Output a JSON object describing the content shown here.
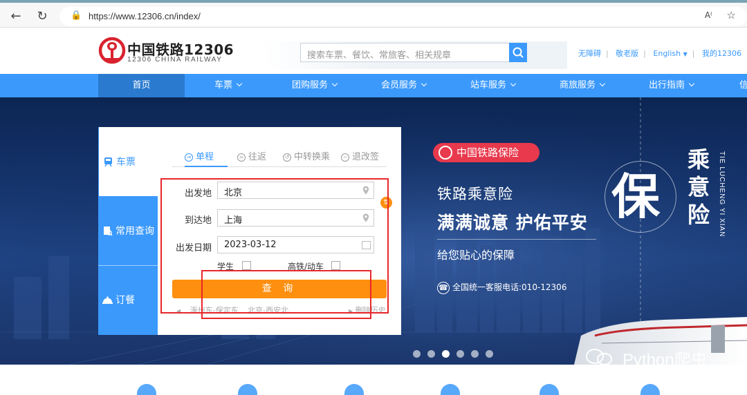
{
  "browser": {
    "url": "https://www.12306.cn/index/"
  },
  "header": {
    "logo_cn": "中国铁路12306",
    "logo_en": "12306 CHINA RAILWAY",
    "search_placeholder": "搜索车票、餐饮、常旅客、相关规章",
    "links": [
      "无障碍",
      "敬老版",
      "English",
      "我的12306"
    ]
  },
  "nav": {
    "items": [
      {
        "label": "首页",
        "dropdown": false
      },
      {
        "label": "车票",
        "dropdown": true
      },
      {
        "label": "团购服务",
        "dropdown": true
      },
      {
        "label": "会员服务",
        "dropdown": true
      },
      {
        "label": "站车服务",
        "dropdown": true
      },
      {
        "label": "商旅服务",
        "dropdown": true
      },
      {
        "label": "出行指南",
        "dropdown": true
      },
      {
        "label": "信",
        "dropdown": false
      }
    ],
    "active_index": 0
  },
  "banner": {
    "badge": "中国铁路保险",
    "title": "铁路乘意险",
    "slogan": "满满诚意 护佑平安",
    "sub": "给您贴心的保障",
    "phone": "全国统一客服电话:010-12306",
    "big_char": "保",
    "vertical_chars": [
      "乘",
      "意",
      "险"
    ],
    "vertical_en": "TIE LUCHENG YI XIAN",
    "dots_count": 6,
    "dots_active": 2,
    "watermark": "Python爬虫"
  },
  "panel": {
    "side_tabs": [
      "车票",
      "常用查询",
      "订餐"
    ],
    "trip_tabs": [
      "单程",
      "往返",
      "中转换乘",
      "退改签"
    ],
    "from_label": "出发地",
    "from_value": "北京",
    "to_label": "到达地",
    "to_value": "上海",
    "date_label": "出发日期",
    "date_value": "2023-03-12",
    "student_label": "学生",
    "gaotie_label": "高铁/动车",
    "query_label": "查 询",
    "history": [
      "涿州东-保定东",
      "北京-西安北"
    ],
    "history_clear": "删除历史"
  },
  "colors": {
    "primary": "#3b99fc",
    "orange": "#ff8f0f",
    "red_annotation": "#e8262a",
    "badge_red": "#e8394d"
  }
}
